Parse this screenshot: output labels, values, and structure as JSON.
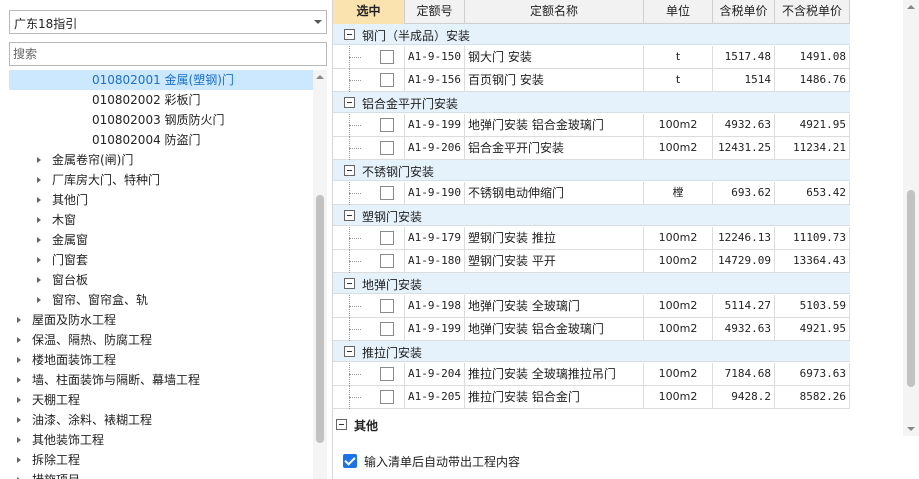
{
  "left": {
    "dropdown_value": "广东18指引",
    "search_placeholder": "搜索",
    "tree": [
      {
        "label": "010802001  金属(塑钢)门",
        "indent": 3,
        "caret": false,
        "selected": true
      },
      {
        "label": "010802002  彩板门",
        "indent": 3,
        "caret": false,
        "selected": false
      },
      {
        "label": "010802003  钢质防火门",
        "indent": 3,
        "caret": false,
        "selected": false
      },
      {
        "label": "010802004  防盗门",
        "indent": 3,
        "caret": false,
        "selected": false
      },
      {
        "label": "金属卷帘(闸)门",
        "indent": 2,
        "caret": true,
        "selected": false
      },
      {
        "label": "厂库房大门、特种门",
        "indent": 2,
        "caret": true,
        "selected": false
      },
      {
        "label": "其他门",
        "indent": 2,
        "caret": true,
        "selected": false
      },
      {
        "label": "木窗",
        "indent": 2,
        "caret": true,
        "selected": false
      },
      {
        "label": "金属窗",
        "indent": 2,
        "caret": true,
        "selected": false
      },
      {
        "label": "门窗套",
        "indent": 2,
        "caret": true,
        "selected": false
      },
      {
        "label": "窗台板",
        "indent": 2,
        "caret": true,
        "selected": false
      },
      {
        "label": "窗帘、窗帘盒、轨",
        "indent": 2,
        "caret": true,
        "selected": false
      },
      {
        "label": "屋面及防水工程",
        "indent": 1,
        "caret": true,
        "selected": false
      },
      {
        "label": "保温、隔热、防腐工程",
        "indent": 1,
        "caret": true,
        "selected": false
      },
      {
        "label": "楼地面装饰工程",
        "indent": 1,
        "caret": true,
        "selected": false
      },
      {
        "label": "墙、柱面装饰与隔断、幕墙工程",
        "indent": 1,
        "caret": true,
        "selected": false
      },
      {
        "label": "天棚工程",
        "indent": 1,
        "caret": true,
        "selected": false
      },
      {
        "label": "油漆、涂料、裱糊工程",
        "indent": 1,
        "caret": true,
        "selected": false
      },
      {
        "label": "其他装饰工程",
        "indent": 1,
        "caret": true,
        "selected": false
      },
      {
        "label": "拆除工程",
        "indent": 1,
        "caret": true,
        "selected": false
      },
      {
        "label": "措施项目",
        "indent": 1,
        "caret": true,
        "selected": false
      }
    ]
  },
  "grid": {
    "headers": [
      "选中",
      "定额号",
      "定额名称",
      "单位",
      "含税单价",
      "不含税单价"
    ],
    "groups": [
      {
        "title": "钢门（半成品）安装",
        "rows": [
          {
            "code": "A1-9-150",
            "name": "钢大门 安装",
            "unit": "t",
            "price_tax": "1517.48",
            "price_notax": "1491.08"
          },
          {
            "code": "A1-9-156",
            "name": "百页钢门 安装",
            "unit": "t",
            "price_tax": "1514",
            "price_notax": "1486.76"
          }
        ]
      },
      {
        "title": "铝合金平开门安装",
        "rows": [
          {
            "code": "A1-9-199",
            "name": "地弹门安装 铝合金玻璃门",
            "unit": "100m2",
            "price_tax": "4932.63",
            "price_notax": "4921.95"
          },
          {
            "code": "A1-9-206",
            "name": "铝合金平开门安装",
            "unit": "100m2",
            "price_tax": "12431.25",
            "price_notax": "11234.21"
          }
        ]
      },
      {
        "title": "不锈钢门安装",
        "rows": [
          {
            "code": "A1-9-190",
            "name": "不锈钢电动伸缩门",
            "unit": "樘",
            "price_tax": "693.62",
            "price_notax": "653.42"
          }
        ]
      },
      {
        "title": "塑钢门安装",
        "rows": [
          {
            "code": "A1-9-179",
            "name": "塑钢门安装 推拉",
            "unit": "100m2",
            "price_tax": "12246.13",
            "price_notax": "11109.73"
          },
          {
            "code": "A1-9-180",
            "name": "塑钢门安装 平开",
            "unit": "100m2",
            "price_tax": "14729.09",
            "price_notax": "13364.43"
          }
        ]
      },
      {
        "title": "地弹门安装",
        "rows": [
          {
            "code": "A1-9-198",
            "name": "地弹门安装 全玻璃门",
            "unit": "100m2",
            "price_tax": "5114.27",
            "price_notax": "5103.59"
          },
          {
            "code": "A1-9-199",
            "name": "地弹门安装 铝合金玻璃门",
            "unit": "100m2",
            "price_tax": "4932.63",
            "price_notax": "4921.95"
          }
        ]
      },
      {
        "title": "推拉门安装",
        "rows": [
          {
            "code": "A1-9-204",
            "name": "推拉门安装 全玻璃推拉吊门",
            "unit": "100m2",
            "price_tax": "7184.68",
            "price_notax": "6973.63"
          },
          {
            "code": "A1-9-205",
            "name": "推拉门安装 铝合金门",
            "unit": "100m2",
            "price_tax": "9428.2",
            "price_notax": "8582.26"
          }
        ]
      }
    ],
    "other_title": "其他"
  },
  "footer": {
    "checkbox_label": "输入清单后自动带出工程内容"
  }
}
